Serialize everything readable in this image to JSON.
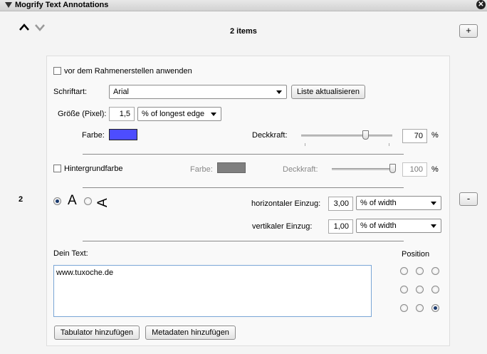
{
  "titlebar": {
    "title": "Mogrify Text Annotations",
    "close_icon": "close-icon"
  },
  "list": {
    "count_label": "2 items",
    "index": "2",
    "add_label": "+",
    "remove_label": "-"
  },
  "options": {
    "apply_before_frame": {
      "label": "vor dem Rahmenerstellen anwenden",
      "checked": false
    },
    "font": {
      "label": "Schriftart:",
      "value": "Arial",
      "refresh_label": "Liste aktualisieren"
    },
    "size": {
      "label": "Größe (Pixel):",
      "value": "1,5",
      "unit": "% of longest edge"
    },
    "color": {
      "label": "Farbe:",
      "value": "#4d4dff"
    },
    "opacity": {
      "label": "Deckkraft:",
      "value": "70",
      "unit": "%",
      "level": 0.7
    },
    "background": {
      "label": "Hintergrundfarbe",
      "checked": false,
      "color_label": "Farbe:",
      "color": "#7f7f7f",
      "opacity_label": "Deckkraft:",
      "opacity_value": "100",
      "opacity_unit": "%",
      "level": 1.0
    },
    "orientation": {
      "selected": "horizontal",
      "horizontal_glyph": "A",
      "vertical_glyph": "A"
    },
    "h_indent": {
      "label": "horizontaler Einzug:",
      "value": "3,00",
      "unit": "% of width"
    },
    "v_indent": {
      "label": "vertikaler Einzug:",
      "value": "1,00",
      "unit": "% of width"
    },
    "text": {
      "label": "Dein Text:",
      "value": "www.tuxoche.de"
    },
    "position": {
      "label": "Position",
      "selected": "bottom-right"
    },
    "buttons": {
      "add_tab": "Tabulator hinzufügen",
      "add_metadata": "Metadaten hinzufügen"
    }
  }
}
